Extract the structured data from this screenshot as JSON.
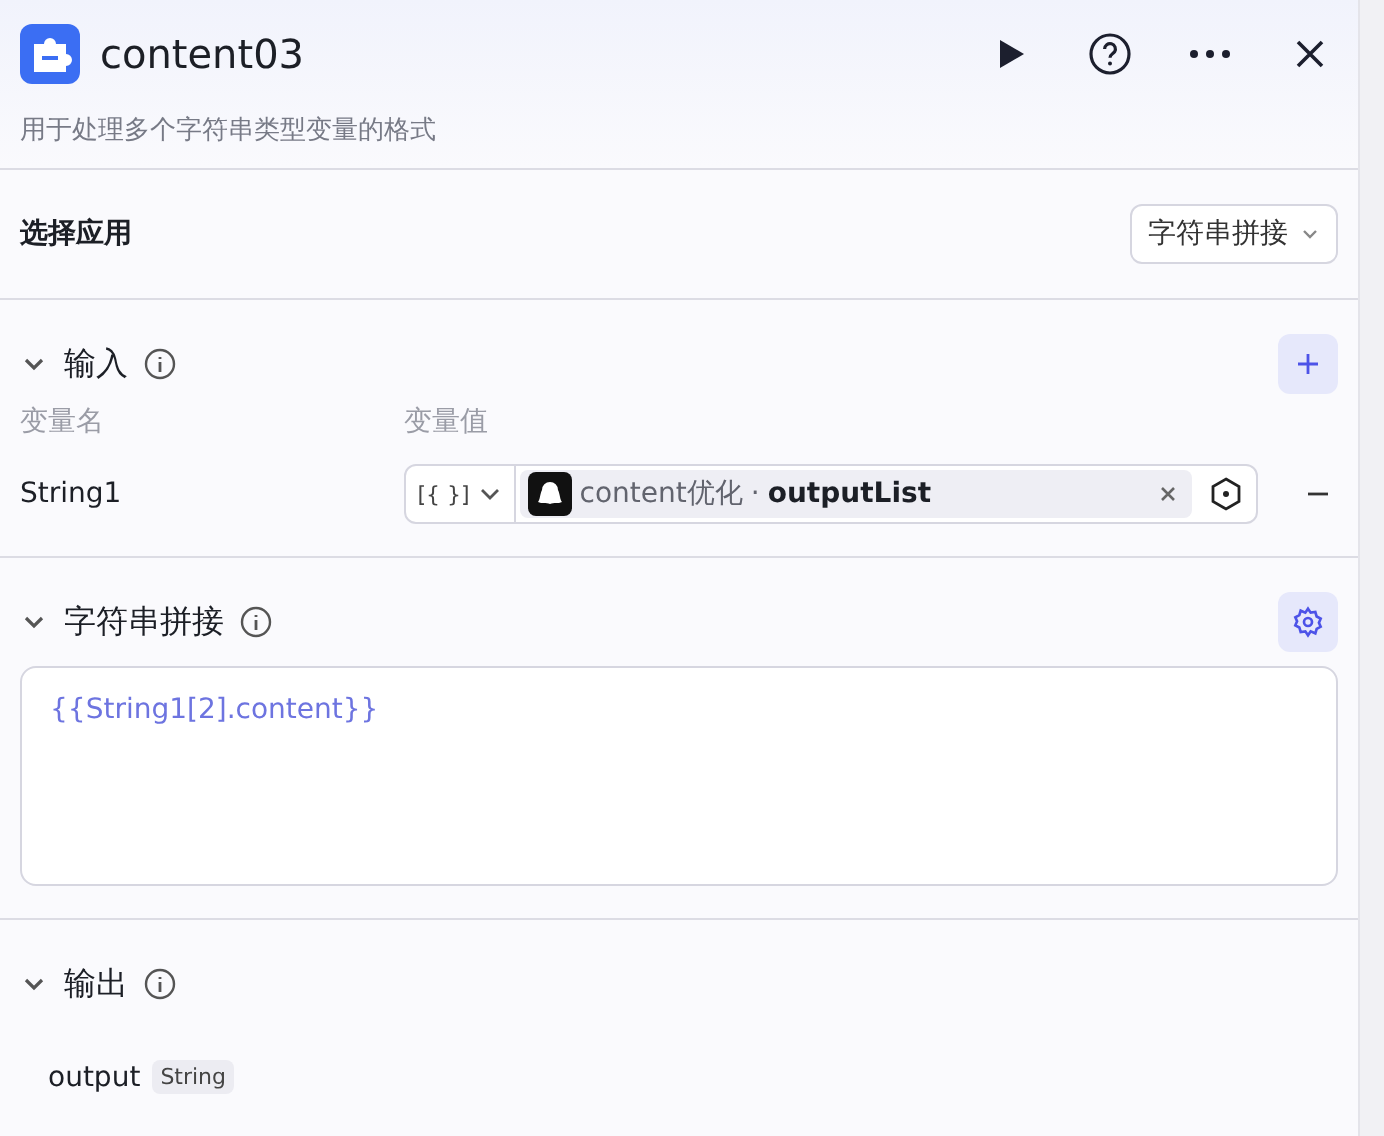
{
  "header": {
    "title": "content03",
    "description": "用于处理多个字符串类型变量的格式"
  },
  "select_app": {
    "label": "选择应用",
    "value": "字符串拼接"
  },
  "input": {
    "title": "输入",
    "expanded": true,
    "columns": [
      "变量名",
      "变量值"
    ],
    "rows": [
      {
        "name": "String1",
        "type_symbol": "[{ }]",
        "source": "content优化",
        "separator": "·",
        "field": "outputList"
      }
    ]
  },
  "concat": {
    "title": "字符串拼接",
    "expanded": true,
    "template": "{{String1[2].content}}"
  },
  "output": {
    "title": "输出",
    "expanded": true,
    "items": [
      {
        "name": "output",
        "type": "String"
      }
    ]
  }
}
